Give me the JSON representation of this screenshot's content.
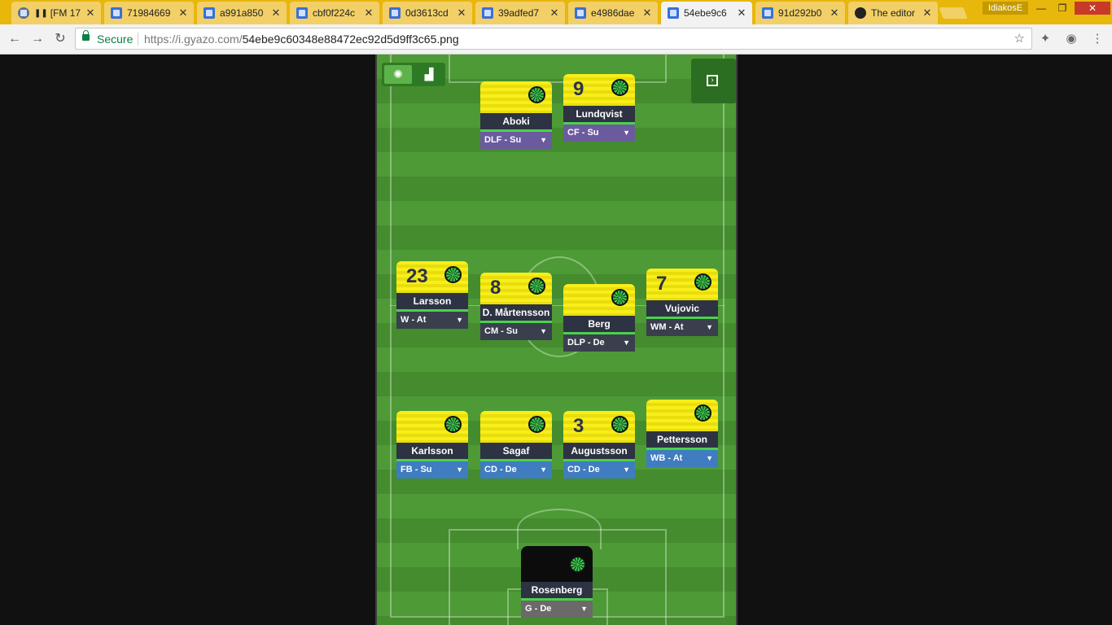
{
  "browser": {
    "tabs": [
      {
        "title": "[FM 17",
        "icon": "steam-icon",
        "paused": true
      },
      {
        "title": "71984669"
      },
      {
        "title": "a991a850"
      },
      {
        "title": "cbf0f224c"
      },
      {
        "title": "0d3613cd"
      },
      {
        "title": "39adfed7"
      },
      {
        "title": "e4986dae"
      },
      {
        "title": "54ebe9c6",
        "active": true
      },
      {
        "title": "91d292b0"
      },
      {
        "title": "The editor",
        "icon": "github-icon"
      }
    ],
    "profile": "IdiakosE",
    "secure_label": "Secure",
    "url_host": "https://i.gyazo.com/",
    "url_path": "54ebe9c60348e88472ec92d5d9ff3c65.png"
  },
  "tactics": {
    "view_toggle": {
      "left_icon": "pitch-icon",
      "right_icon": "bar-chart-icon"
    },
    "side_panel_icon": "expand-panel-icon",
    "players": [
      {
        "id": "aboki",
        "number": "",
        "name": "Aboki",
        "role": "DLF - Su",
        "role_type": "att"
      },
      {
        "id": "lundqvist",
        "number": "9",
        "name": "Lundqvist",
        "role": "CF - Su",
        "role_type": "att"
      },
      {
        "id": "larsson",
        "number": "23",
        "name": "Larsson",
        "role": "W - At",
        "role_type": "mid"
      },
      {
        "id": "martensson",
        "number": "8",
        "name": "D. Mårtensson",
        "role": "CM - Su",
        "role_type": "mid"
      },
      {
        "id": "berg",
        "number": "",
        "name": "Berg",
        "role": "DLP - De",
        "role_type": "mid"
      },
      {
        "id": "vujovic",
        "number": "7",
        "name": "Vujovic",
        "role": "WM - At",
        "role_type": "mid"
      },
      {
        "id": "karlsson",
        "number": "",
        "name": "Karlsson",
        "role": "FB - Su",
        "role_type": "def"
      },
      {
        "id": "sagaf",
        "number": "",
        "name": "Sagaf",
        "role": "CD - De",
        "role_type": "def"
      },
      {
        "id": "augustsson",
        "number": "3",
        "name": "Augustsson",
        "role": "CD - De",
        "role_type": "def"
      },
      {
        "id": "pettersson",
        "number": "",
        "name": "Pettersson",
        "role": "WB - At",
        "role_type": "def"
      },
      {
        "id": "rosenberg",
        "number": "",
        "name": "Rosenberg",
        "role": "G - De",
        "role_type": "gk"
      }
    ]
  }
}
